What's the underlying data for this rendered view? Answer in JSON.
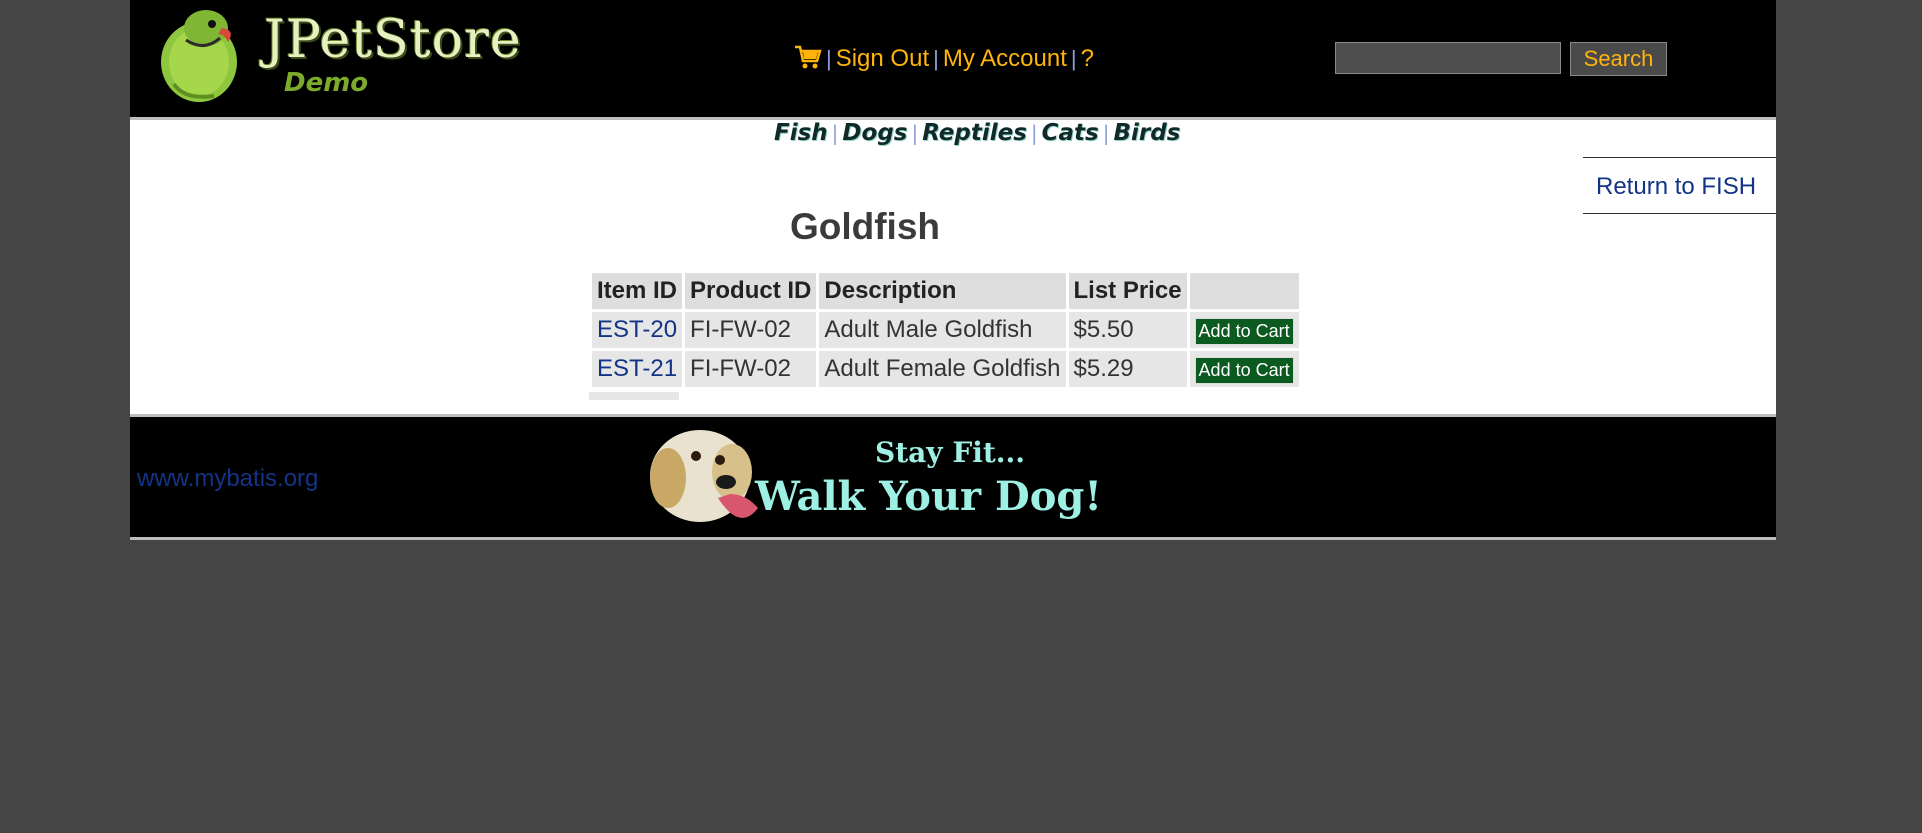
{
  "header": {
    "logo_text": "JPetStore",
    "logo_sub": "Demo",
    "menu": {
      "sign_out": "Sign Out",
      "my_account": "My Account",
      "help": "?"
    },
    "search": {
      "value": "",
      "button_label": "Search"
    }
  },
  "quicklinks": [
    "Fish",
    "Dogs",
    "Reptiles",
    "Cats",
    "Birds"
  ],
  "back_link": "Return to FISH",
  "product": {
    "title": "Goldfish",
    "columns": [
      "Item ID",
      "Product ID",
      "Description",
      "List Price"
    ],
    "rows": [
      {
        "item_id": "EST-20",
        "product_id": "FI-FW-02",
        "description": "Adult Male Goldfish",
        "price": "$5.50",
        "action": "Add to Cart"
      },
      {
        "item_id": "EST-21",
        "product_id": "FI-FW-02",
        "description": "Adult Female Goldfish",
        "price": "$5.29",
        "action": "Add to Cart"
      }
    ]
  },
  "footer": {
    "link": "www.mybatis.org",
    "banner_line1": "Stay Fit...",
    "banner_line2": "Walk Your Dog!"
  },
  "colors": {
    "page_bg": "#454545",
    "header_bg": "#000000",
    "menu_text": "#ffb40c",
    "link": "#133486",
    "add_button": "#0b5a1f"
  }
}
